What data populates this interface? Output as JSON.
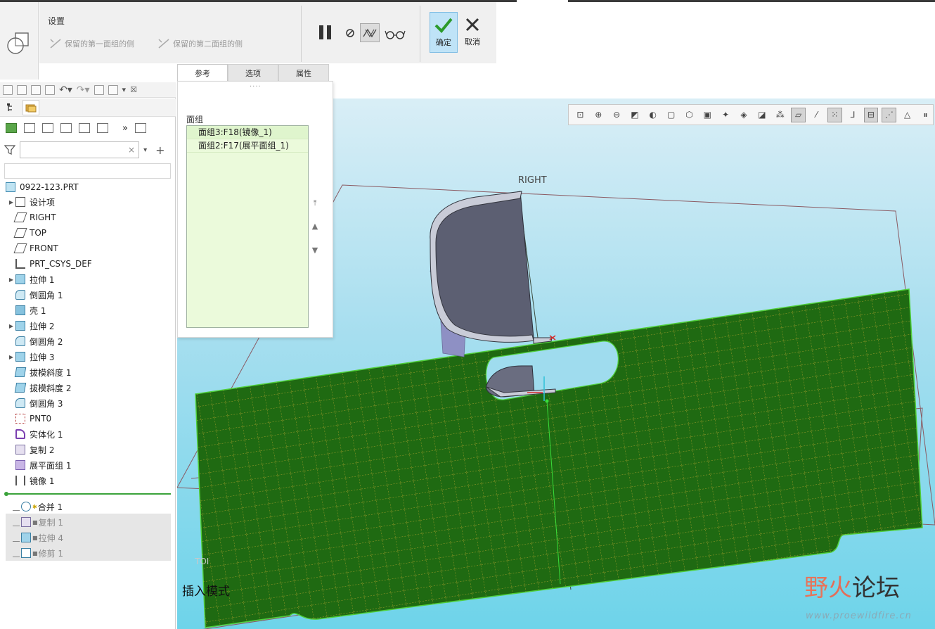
{
  "dashboard": {
    "section_label": "设置",
    "option_keep_first": "保留的第一面组的侧",
    "option_keep_second": "保留的第二面组的侧",
    "ok_label": "确定",
    "cancel_label": "取消",
    "tabs": [
      {
        "label": "参考",
        "active": true
      },
      {
        "label": "选项",
        "active": false
      },
      {
        "label": "属性",
        "active": false
      }
    ]
  },
  "reference_panel": {
    "title": "面组",
    "items": [
      "面组3:F18(镜像_1)",
      "面组2:F17(展平面组_1)"
    ]
  },
  "model_tree": {
    "search_placeholder": "",
    "root": "0922-123.PRT",
    "items": [
      {
        "label": "设计项",
        "icon": "design-items-icon",
        "expandable": true
      },
      {
        "label": "RIGHT",
        "icon": "datum-plane-icon",
        "expandable": false
      },
      {
        "label": "TOP",
        "icon": "datum-plane-icon",
        "expandable": false
      },
      {
        "label": "FRONT",
        "icon": "datum-plane-icon",
        "expandable": false
      },
      {
        "label": "PRT_CSYS_DEF",
        "icon": "csys-icon",
        "expandable": false
      },
      {
        "label": "拉伸 1",
        "icon": "extrude-icon",
        "expandable": true
      },
      {
        "label": "倒圆角 1",
        "icon": "round-icon",
        "expandable": false
      },
      {
        "label": "壳 1",
        "icon": "shell-icon",
        "expandable": false
      },
      {
        "label": "拉伸 2",
        "icon": "extrude-icon",
        "expandable": true
      },
      {
        "label": "倒圆角 2",
        "icon": "round-icon",
        "expandable": false
      },
      {
        "label": "拉伸 3",
        "icon": "extrude-icon",
        "expandable": true
      },
      {
        "label": "拔模斜度 1",
        "icon": "draft-icon",
        "expandable": false
      },
      {
        "label": "拔模斜度 2",
        "icon": "draft-icon",
        "expandable": false
      },
      {
        "label": "倒圆角 3",
        "icon": "round-icon",
        "expandable": false
      },
      {
        "label": "PNT0",
        "icon": "datum-point-icon",
        "expandable": false
      },
      {
        "label": "实体化 1",
        "icon": "solidify-icon",
        "expandable": false
      },
      {
        "label": "复制 2",
        "icon": "copy-icon",
        "expandable": false
      },
      {
        "label": "展平面组 1",
        "icon": "flatten-quilt-icon",
        "expandable": false
      },
      {
        "label": "镜像 1",
        "icon": "mirror-icon",
        "expandable": false
      }
    ],
    "after_insert": [
      {
        "label": "合并 1",
        "icon": "merge-icon",
        "active": true
      },
      {
        "label": "复制 1",
        "icon": "copy-icon",
        "active": false
      },
      {
        "label": "拉伸 4",
        "icon": "extrude-icon",
        "active": false
      },
      {
        "label": "修剪 1",
        "icon": "trim-icon",
        "active": false
      }
    ]
  },
  "viewport": {
    "datum_label": "RIGHT",
    "corner_label": "TOI",
    "status_text": "插入模式"
  },
  "watermark": {
    "logo_part1": "野",
    "logo_part2": "火",
    "logo_part3": "论坛",
    "url": "www.proewildfire.cn"
  },
  "colors": {
    "accent": "#3aa33a",
    "quilt": "#1f6a12",
    "ok_bg": "#bfe3f7",
    "viewport_top": "#d9eef6",
    "viewport_bottom": "#6ed4ea"
  }
}
